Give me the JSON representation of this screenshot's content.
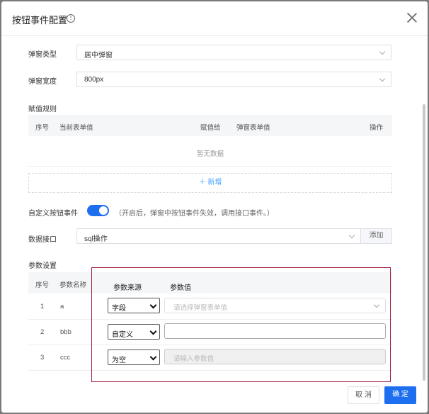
{
  "dialog": {
    "title": "按钮事件配置",
    "info_icon": "info-icon",
    "close_icon": "close-icon"
  },
  "form": {
    "popup_type_label": "弹窗类型",
    "popup_type_value": "居中弹窗",
    "popup_width_label": "弹窗宽度",
    "popup_width_value": "800px",
    "assign_rule_label": "赋值规则",
    "assign_columns": [
      "序号",
      "当前表单值",
      "赋值给",
      "弹窗表单值",
      "操作"
    ],
    "empty_text": "暂无数据",
    "add_row_label": "＋ 新增",
    "custom_event_label": "自定义按钮事件",
    "custom_event_enabled": true,
    "custom_event_hint": "（开启后，弹窗中按钮事件失效，调用接口事件。）",
    "data_api_label": "数据接口",
    "data_api_value": "sql操作",
    "add_button": "添加",
    "param_label": "参数设置",
    "param_columns": [
      "序号",
      "参数名称",
      "参数来源",
      "参数值"
    ],
    "params": [
      {
        "no": "1",
        "name": "a",
        "source": "字段",
        "value_placeholder": "请选择弹窗表单值",
        "value_kind": "select"
      },
      {
        "no": "2",
        "name": "bbb",
        "source": "自定义",
        "value_placeholder": "",
        "value_kind": "input"
      },
      {
        "no": "3",
        "name": "ccc",
        "source": "为空",
        "value_placeholder": "请输入参数值",
        "value_kind": "disabled"
      }
    ]
  },
  "footer": {
    "cancel": "取 消",
    "confirm": "确 定"
  },
  "colors": {
    "primary": "#1e6ff0",
    "highlight_border": "#a31b3a"
  }
}
